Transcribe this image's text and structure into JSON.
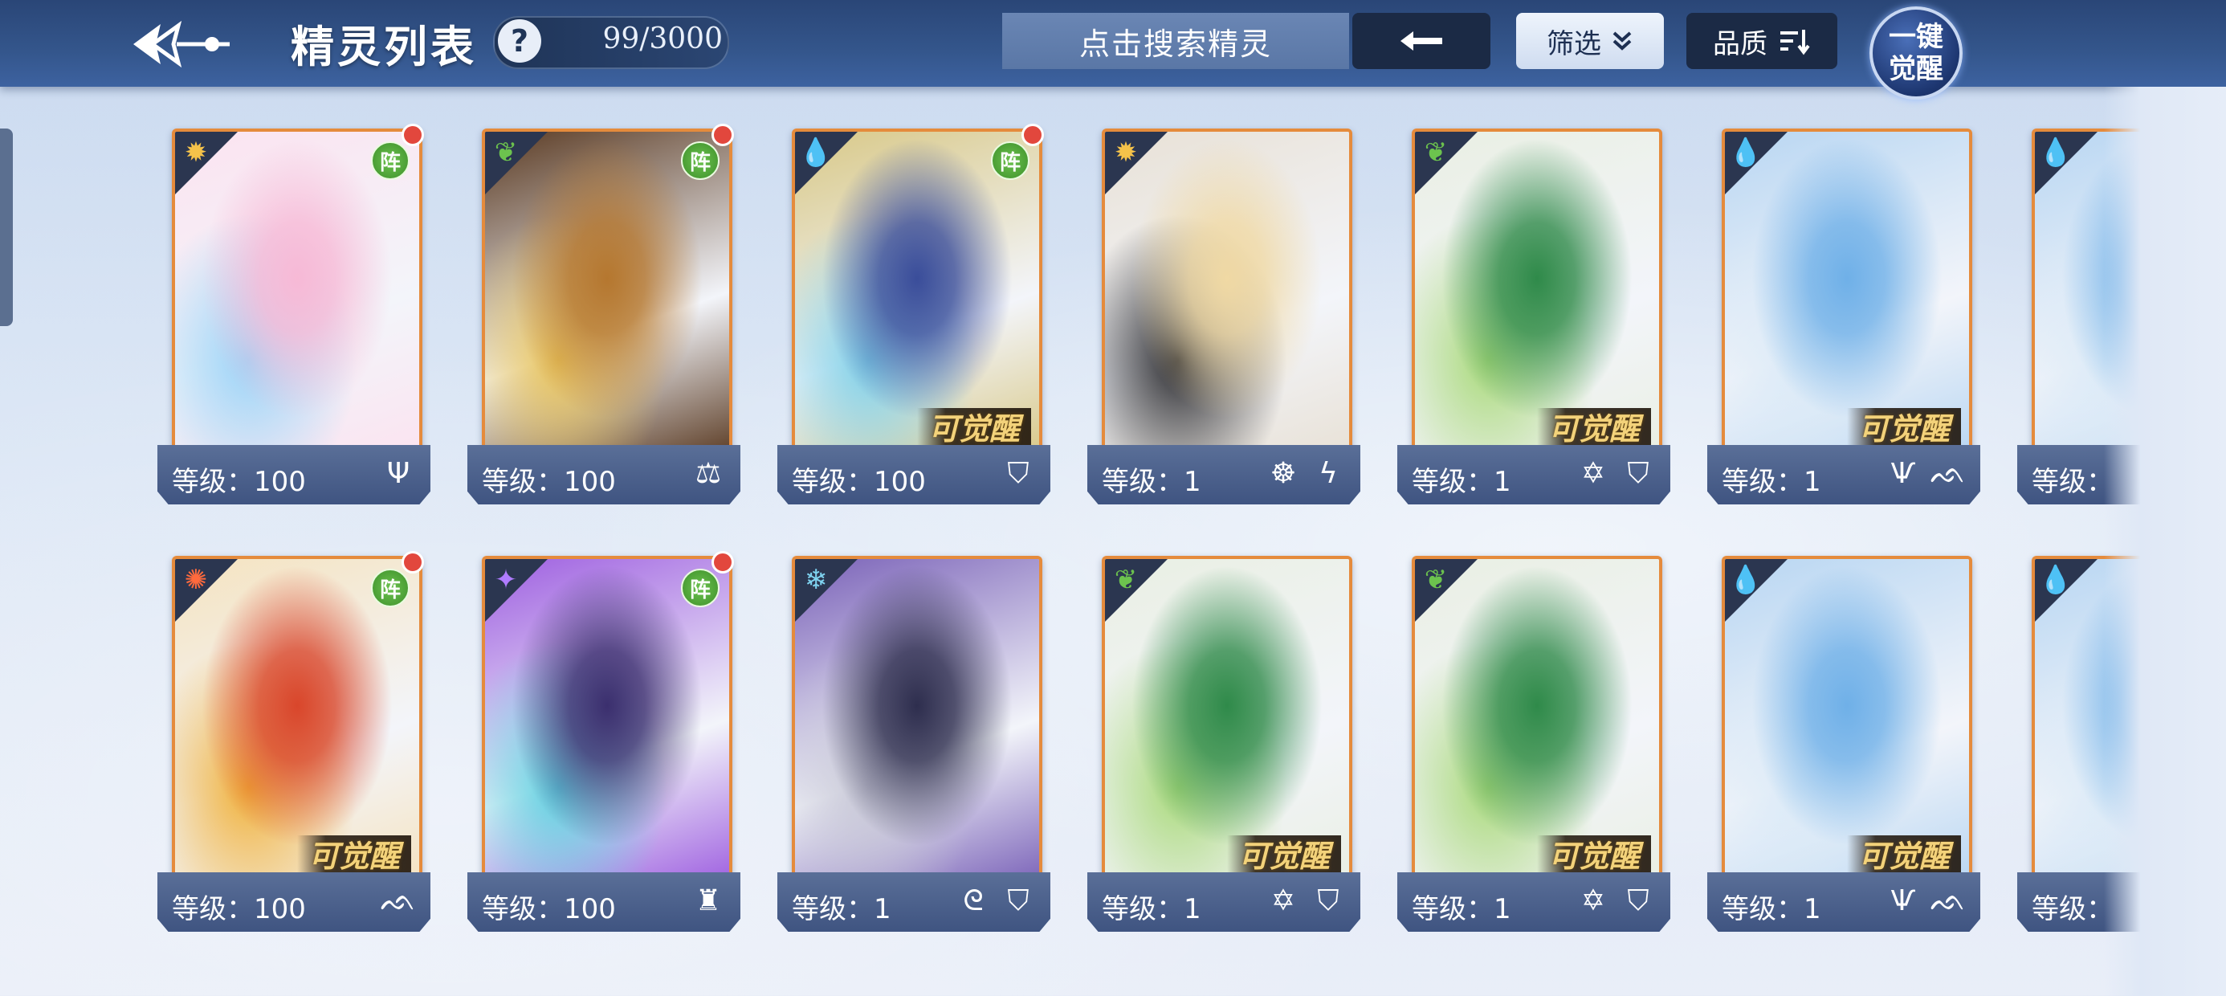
{
  "header": {
    "title": "精灵列表",
    "help": "?",
    "count": "99/3000",
    "search_placeholder": "点击搜索精灵",
    "filter_label": "筛选",
    "quality_label": "品质",
    "awaken_all_label": "一键觉醒"
  },
  "level_prefix": "等级：",
  "formation_label": "阵",
  "awaken_tag": "可觉醒",
  "colors": {
    "header": "#34568c",
    "card_border": "#e58b3c",
    "awaken_gold": "#f3d27a",
    "formation_green": "#4ea83a",
    "red_dot": "#e2473d"
  },
  "cards": [
    {
      "level": "等级：100",
      "element": "light-icon",
      "formation": true,
      "red_dot": true,
      "awakenable": false,
      "skills": [
        "trident-icon"
      ]
    },
    {
      "level": "等级：100",
      "element": "grass-icon",
      "formation": true,
      "red_dot": true,
      "awakenable": false,
      "skills": [
        "scales-icon"
      ]
    },
    {
      "level": "等级：100",
      "element": "water-icon",
      "formation": true,
      "red_dot": true,
      "awakenable": true,
      "skills": [
        "shield-icon"
      ]
    },
    {
      "level": "等级：1",
      "element": "light-icon",
      "formation": false,
      "red_dot": false,
      "awakenable": false,
      "skills": [
        "triskelion-icon",
        "lightning-icon"
      ]
    },
    {
      "level": "等级：1",
      "element": "grass-icon",
      "formation": false,
      "red_dot": false,
      "awakenable": true,
      "skills": [
        "hexagram-icon",
        "shield-icon"
      ]
    },
    {
      "level": "等级：1",
      "element": "water-icon",
      "formation": false,
      "red_dot": false,
      "awakenable": true,
      "skills": [
        "claw-icon",
        "wing-icon"
      ]
    },
    {
      "level": "等级：",
      "element": "water-icon",
      "formation": false,
      "red_dot": false,
      "awakenable": false,
      "skills": []
    },
    {
      "level": "等级：100",
      "element": "fire-icon",
      "formation": true,
      "red_dot": true,
      "awakenable": true,
      "skills": [
        "wing-icon"
      ]
    },
    {
      "level": "等级：100",
      "element": "shadow-icon",
      "formation": true,
      "red_dot": true,
      "awakenable": false,
      "skills": [
        "rune-icon"
      ]
    },
    {
      "level": "等级：1",
      "element": "ice-icon",
      "formation": false,
      "red_dot": false,
      "awakenable": false,
      "skills": [
        "swirl-icon",
        "shield-icon"
      ]
    },
    {
      "level": "等级：1",
      "element": "grass-icon",
      "formation": false,
      "red_dot": false,
      "awakenable": true,
      "skills": [
        "hexagram-icon",
        "shield-icon"
      ]
    },
    {
      "level": "等级：1",
      "element": "grass-icon",
      "formation": false,
      "red_dot": false,
      "awakenable": true,
      "skills": [
        "hexagram-icon",
        "shield-icon"
      ]
    },
    {
      "level": "等级：1",
      "element": "water-icon",
      "formation": false,
      "red_dot": false,
      "awakenable": true,
      "skills": [
        "claw-icon",
        "wing-icon"
      ]
    },
    {
      "level": "等级：",
      "element": "water-icon",
      "formation": false,
      "red_dot": false,
      "awakenable": false,
      "skills": []
    }
  ]
}
